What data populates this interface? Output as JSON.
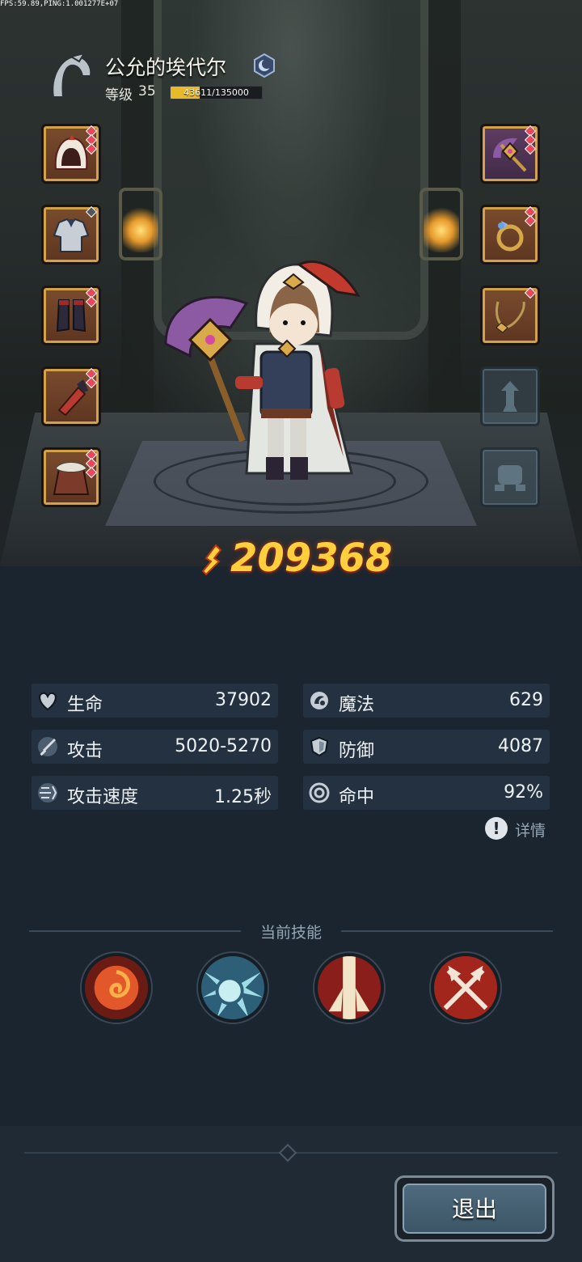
{
  "hud": {
    "debug_text": "FPS:59.89,PING:1.001277E+07"
  },
  "character": {
    "name": "公允的埃代尔",
    "level_label": "等级",
    "level": "35",
    "xp_text": "43611/135000",
    "xp_progress": 0.323,
    "power": "209368"
  },
  "stats": [
    {
      "label": "生命",
      "value": "37902",
      "icon": "heart-icon"
    },
    {
      "label": "魔法",
      "value": "629",
      "icon": "magic-icon"
    },
    {
      "label": "攻击",
      "value": "5020-5270",
      "icon": "sword-icon"
    },
    {
      "label": "防御",
      "value": "4087",
      "icon": "shield-icon"
    },
    {
      "label": "攻击速度",
      "value": "1.25秒",
      "icon": "speed-icon"
    },
    {
      "label": "命中",
      "value": "92%",
      "icon": "target-icon"
    }
  ],
  "details_label": "详情",
  "skills": {
    "title": "当前技能",
    "items": [
      "fire-vortex-skill-icon",
      "light-burst-skill-icon",
      "holy-pillar-skill-icon",
      "crossed-axes-skill-icon"
    ]
  },
  "exit_label": "退出",
  "colors": {
    "accent_gold": "#ffcf3e",
    "panel": "#243140",
    "background": "#1b2530"
  }
}
